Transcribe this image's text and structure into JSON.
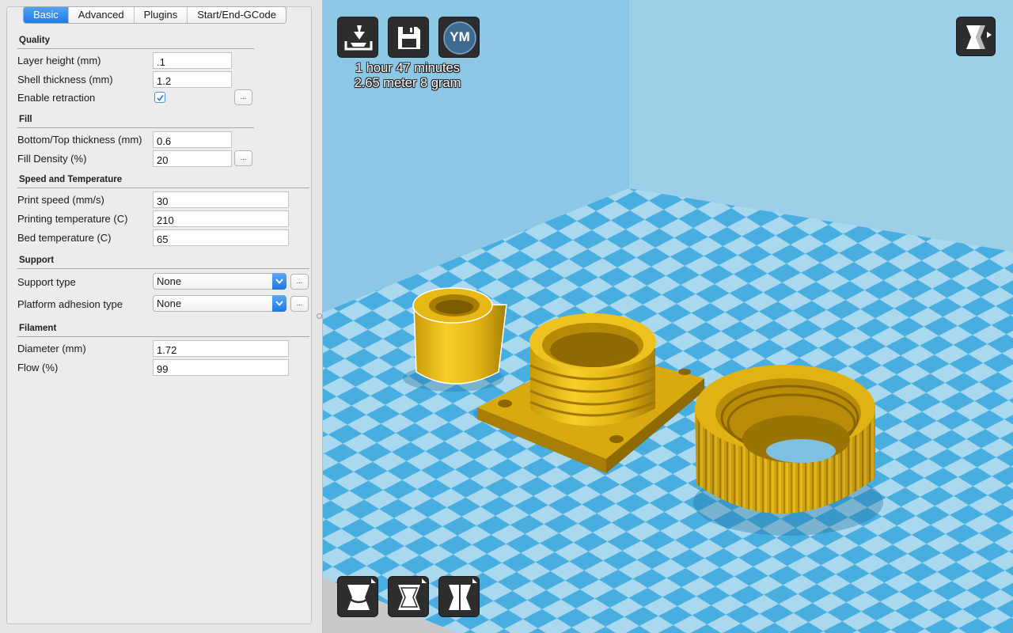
{
  "tabs": [
    {
      "label": "Basic",
      "active": true
    },
    {
      "label": "Advanced",
      "active": false
    },
    {
      "label": "Plugins",
      "active": false
    },
    {
      "label": "Start/End-GCode",
      "active": false
    }
  ],
  "quality": {
    "title": "Quality",
    "layer_height_label": "Layer height (mm)",
    "layer_height_value": ".1",
    "shell_thickness_label": "Shell thickness (mm)",
    "shell_thickness_value": "1.2",
    "retraction_label": "Enable retraction",
    "retraction_checked": true,
    "more_button": "..."
  },
  "fill": {
    "title": "Fill",
    "bottom_top_label": "Bottom/Top thickness (mm)",
    "bottom_top_value": "0.6",
    "density_label": "Fill Density (%)",
    "density_value": "20",
    "more_button": "..."
  },
  "speed": {
    "title": "Speed and Temperature",
    "print_speed_label": "Print speed (mm/s)",
    "print_speed_value": "30",
    "print_temp_label": "Printing temperature (C)",
    "print_temp_value": "210",
    "bed_temp_label": "Bed temperature (C)",
    "bed_temp_value": "65"
  },
  "support": {
    "title": "Support",
    "type_label": "Support type",
    "type_value": "None",
    "adhesion_label": "Platform adhesion type",
    "adhesion_value": "None",
    "more_button": "..."
  },
  "filament": {
    "title": "Filament",
    "diameter_label": "Diameter (mm)",
    "diameter_value": "1.72",
    "flow_label": "Flow (%)",
    "flow_value": "99"
  },
  "viewport": {
    "toolbar": {
      "load_icon": "load-model-icon",
      "save_icon": "save-floppy-icon",
      "ym_label": "YM",
      "view_mode_icon": "view-mode-icon"
    },
    "stats": {
      "time": "1 hour 47 minutes",
      "material": "2.65 meter 8 gram"
    },
    "bottom_tools": [
      "rotate-icon",
      "scale-icon",
      "mirror-icon"
    ],
    "colors": {
      "model": "#e8b814",
      "bed_light": "#a9d8ef",
      "bed_dark": "#48aee0",
      "wall": "#8cc8e6"
    }
  }
}
